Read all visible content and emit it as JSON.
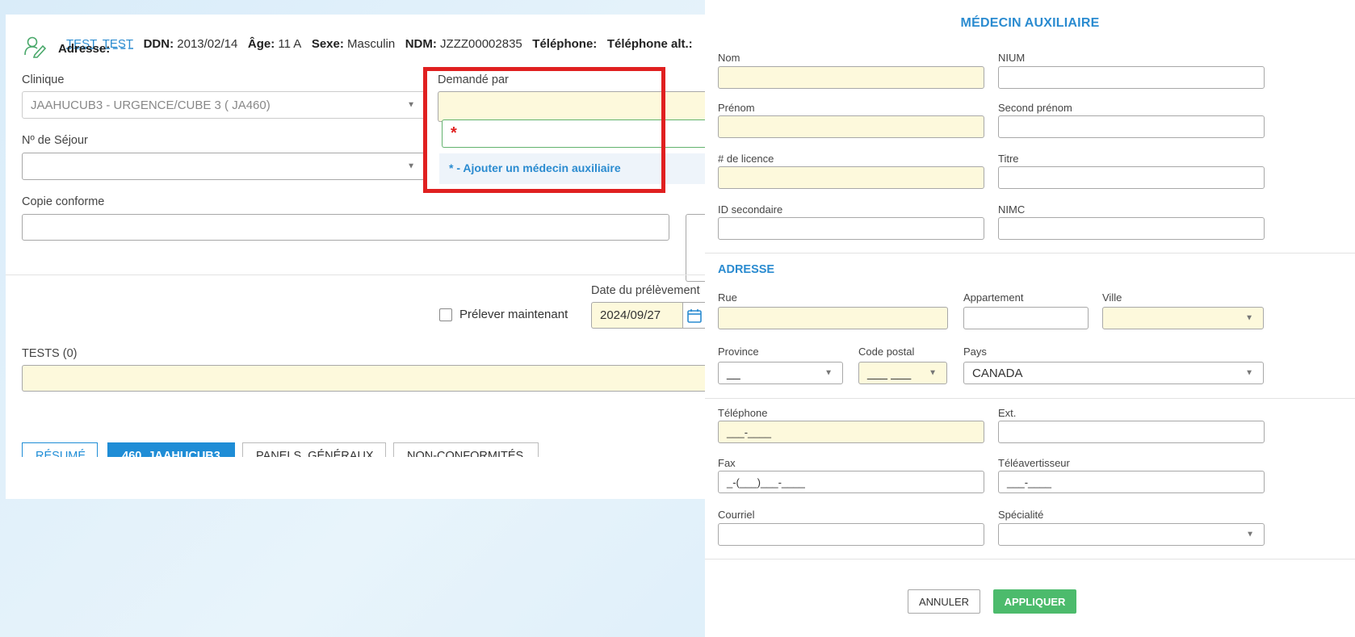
{
  "patient": {
    "name": "TEST, TEST",
    "ddn_label": "DDN:",
    "ddn": "2013/02/14",
    "age_label": "Âge:",
    "age": "11 A",
    "sexe_label": "Sexe:",
    "sexe": "Masculin",
    "ndm_label": "NDM:",
    "ndm": "JZZZ00002835",
    "tel_label": "Téléphone:",
    "tel_alt_label": "Téléphone alt.:",
    "adresse_label": "Adresse:"
  },
  "form": {
    "clinique_label": "Clinique",
    "clinique_value": "JAAHUCUB3 - URGENCE/CUBE 3 ( JA460)",
    "sejour_label": "Nº de Séjour",
    "copie_label": "Copie conforme",
    "demande_label": "Demandé par",
    "search_value": "*",
    "dropdown_option": "* - Ajouter un médecin auxiliaire",
    "prelever_label": "Prélever maintenant",
    "date_label": "Date du prélèvement",
    "date_value": "2024/09/27",
    "tests_label": "TESTS (0)"
  },
  "tabs": [
    {
      "label": "RÉSUMÉ"
    },
    {
      "label": "460_JAAHUCUB3"
    },
    {
      "label": "PANELS_GÉNÉRAUX"
    },
    {
      "label": "NON-CONFORMITÉS"
    }
  ],
  "modal": {
    "title": "MÉDECIN AUXILIAIRE",
    "nom": "Nom",
    "nium": "NIUM",
    "prenom": "Prénom",
    "second_prenom": "Second prénom",
    "licence": "# de licence",
    "titre": "Titre",
    "id_secondaire": "ID secondaire",
    "nimc": "NIMC",
    "adresse_section": "ADRESSE",
    "rue": "Rue",
    "appartement": "Appartement",
    "ville": "Ville",
    "province": "Province",
    "province_value": "__",
    "code_postal": "Code postal",
    "code_postal_value": "___ ___",
    "pays": "Pays",
    "pays_value": "CANADA",
    "telephone": "Téléphone",
    "telephone_value": "___-____",
    "ext": "Ext.",
    "fax": "Fax",
    "fax_value": "_-(___)___-____",
    "teleavertisseur": "Téléavertisseur",
    "teleavertisseur_value": "___-____",
    "courriel": "Courriel",
    "specialite": "Spécialité",
    "annuler": "ANNULER",
    "appliquer": "APPLIQUER"
  },
  "colors": {
    "accent": "#2a8bd0",
    "required_bg": "#fdf9dc",
    "highlight_box": "#e02020",
    "apply_green": "#4cbb6c"
  }
}
